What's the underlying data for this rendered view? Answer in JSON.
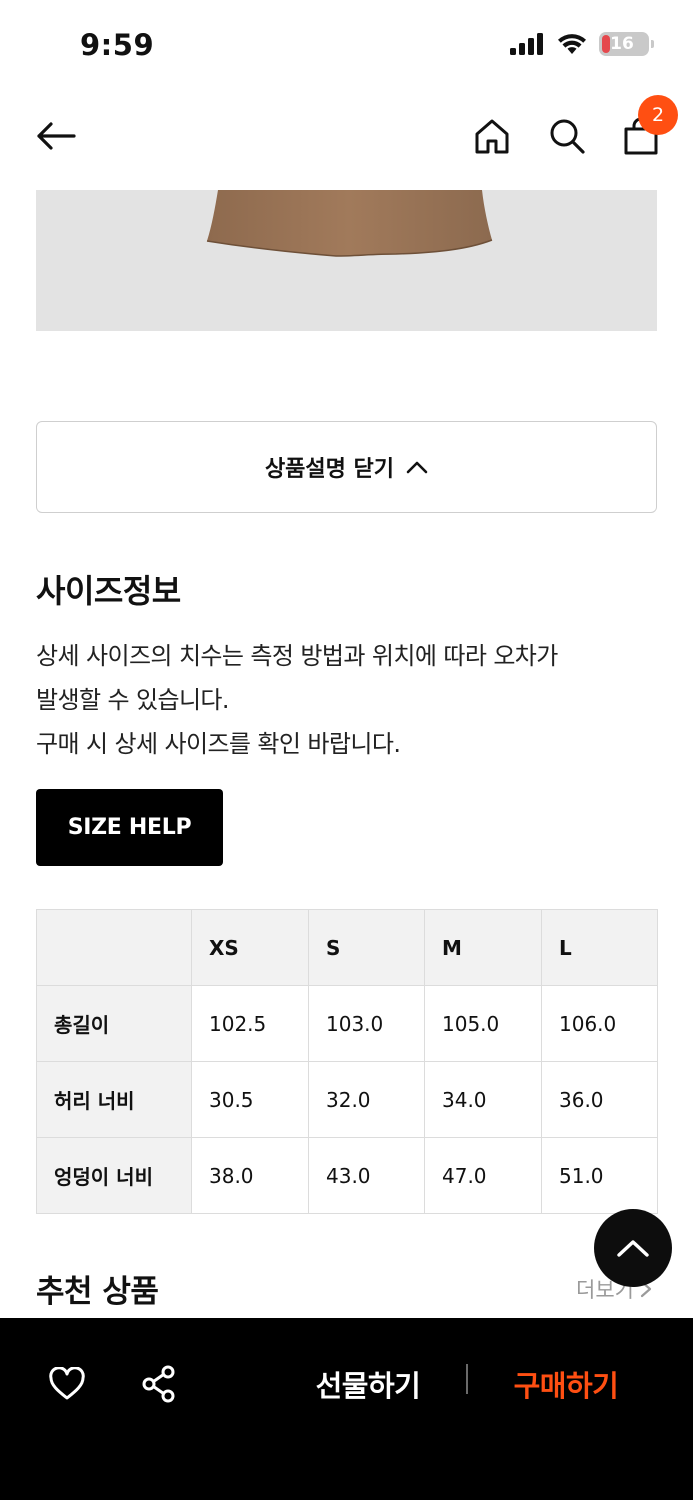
{
  "status_bar": {
    "time": "9:59",
    "battery_level": "16"
  },
  "nav": {
    "back_icon": "arrow-left-icon",
    "home_icon": "home-icon",
    "search_icon": "search-icon",
    "cart_icon": "shopping-bag-icon",
    "cart_count": "2"
  },
  "description_toggle": {
    "label": "상품설명 닫기",
    "icon": "chevron-up-icon"
  },
  "size_info": {
    "title": "사이즈정보",
    "description_line1": "상세 사이즈의 치수는 측정 방법과 위치에 따라 오차가",
    "description_line2": "발생할 수 있습니다.",
    "description_line3": "구매 시 상세 사이즈를 확인 바랍니다.",
    "help_button": "SIZE HELP"
  },
  "size_table": {
    "headers": [
      "",
      "XS",
      "S",
      "M",
      "L"
    ],
    "rows": [
      {
        "label": "총길이",
        "values": [
          "102.5",
          "103.0",
          "105.0",
          "106.0"
        ]
      },
      {
        "label": "허리 너비",
        "values": [
          "30.5",
          "32.0",
          "34.0",
          "36.0"
        ]
      },
      {
        "label": "엉덩이 너비",
        "values": [
          "38.0",
          "43.0",
          "47.0",
          "51.0"
        ]
      }
    ]
  },
  "recommendations": {
    "title": "추천 상품",
    "more_label": "더보기"
  },
  "bottom_bar": {
    "like_icon": "heart-icon",
    "share_icon": "share-icon",
    "gift_label": "선물하기",
    "buy_label": "구매하기"
  },
  "colors": {
    "accent": "#ff4f12",
    "bar_bg": "#000000",
    "table_header_bg": "#f2f2f2"
  }
}
